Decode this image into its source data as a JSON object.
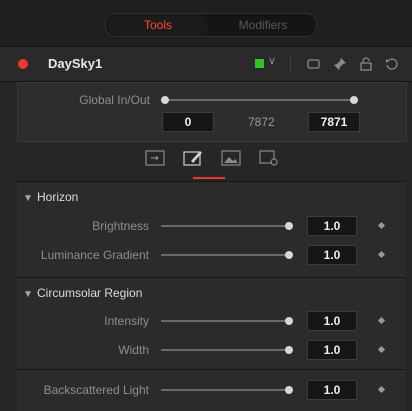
{
  "top_tabs": {
    "tools": "Tools",
    "modifiers": "Modifiers"
  },
  "node": {
    "name": "DaySky1",
    "color": "#38c02a"
  },
  "global_inout": {
    "label": "Global In/Out",
    "start": "0",
    "middle": "7872",
    "end": "7871"
  },
  "horizon": {
    "title": "Horizon",
    "rows": [
      {
        "label": "Brightness",
        "value": "1.0"
      },
      {
        "label": "Luminance Gradient",
        "value": "1.0"
      }
    ]
  },
  "circumsolar": {
    "title": "Circumsolar Region",
    "rows": [
      {
        "label": "Intensity",
        "value": "1.0"
      },
      {
        "label": "Width",
        "value": "1.0"
      }
    ]
  },
  "backscattered": {
    "label": "Backscattered Light",
    "value": "1.0"
  },
  "colors": {
    "accent": "#e8392b",
    "tab_active": "#ff4b2e",
    "node_color": "#38c02a"
  }
}
